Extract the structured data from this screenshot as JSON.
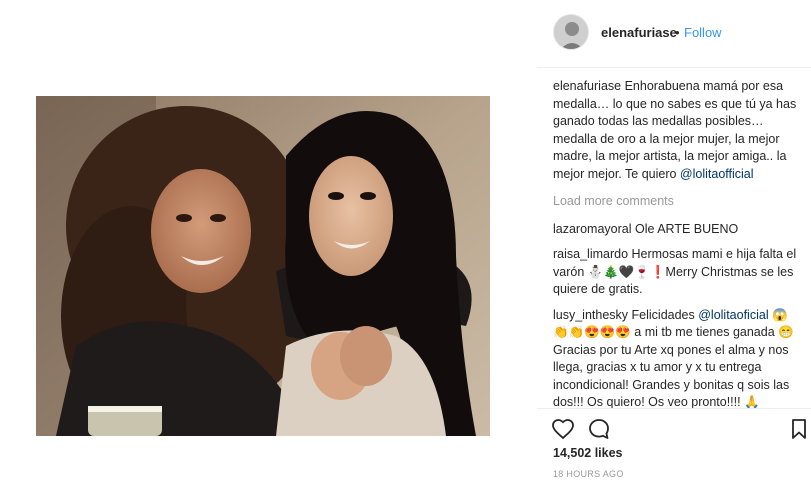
{
  "header": {
    "username": "elenafuriase",
    "separator": "•",
    "follow_label": "Follow"
  },
  "caption": {
    "username": "elenafuriase",
    "text": " Enhorabuena mamá por esa medalla… lo que no sabes es que tú ya has ganado todas las medallas posibles…medalla de oro a la mejor mujer, la mejor madre, la mejor artista, la mejor amiga.. la mejor mejor. Te quiero ",
    "mention": "@lolitaofficial"
  },
  "load_more_label": "Load more comments",
  "comments": [
    {
      "username": "lazaromayoral",
      "text": " Ole ARTE BUENO"
    },
    {
      "username": "raisa_limardo",
      "text": " Hermosas mami e hija falta el varón ⛄🎄🖤🍷❗Merry Christmas se les quiere de gratis."
    },
    {
      "username": "lusy_inthesky",
      "text": " Felicidades ",
      "mention": "@lolitaoficial",
      "text2": " 😱👏👏😍😍😍 a mi tb me tienes ganada 😁 Gracias por tu Arte xq pones el alma y nos llega, gracias x tu amor y x tu entrega incondicional! Grandes y bonitas q sois las dos!!! Os quiero! Os veo pronto!!!! 🙏"
    }
  ],
  "actions": {
    "like_icon": "heart-icon",
    "comment_icon": "comment-icon",
    "save_icon": "bookmark-icon"
  },
  "likes_label": "14,502 likes",
  "time_ago": "18 HOURS AGO",
  "colors": {
    "link_blue": "#3897f0",
    "mention_navy": "#003569",
    "muted_gray": "#999999",
    "text": "#262626"
  }
}
